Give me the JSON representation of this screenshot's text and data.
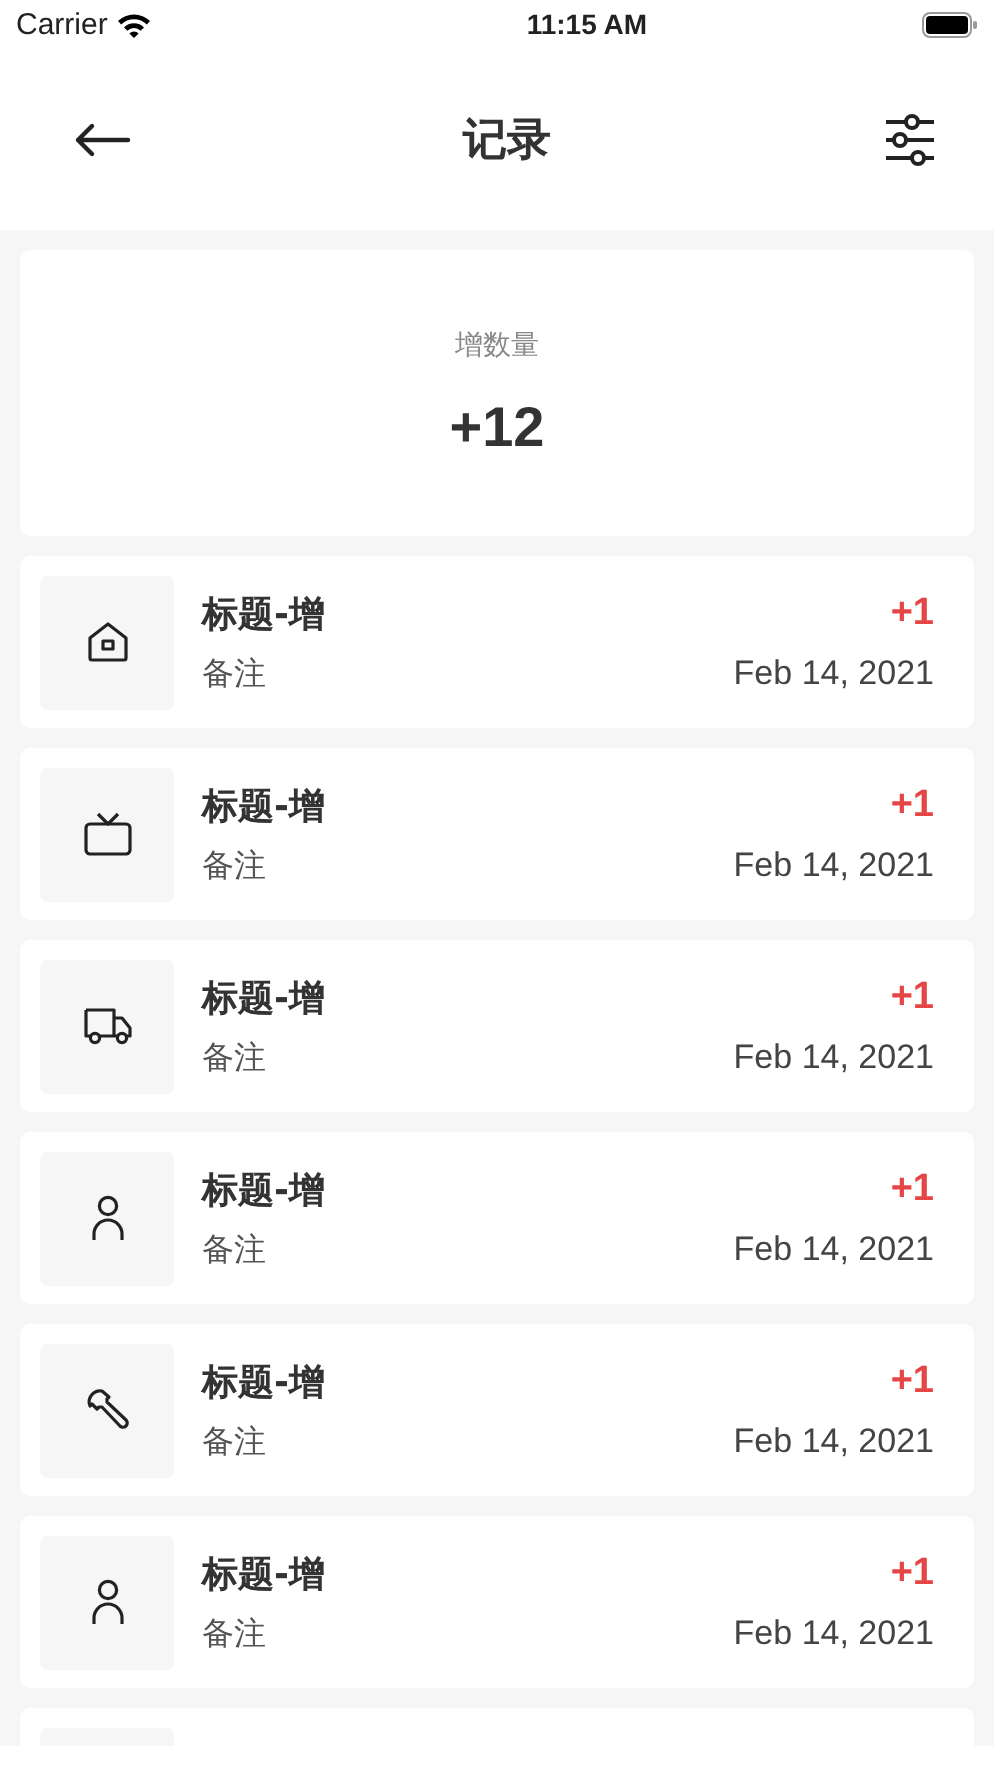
{
  "status_bar": {
    "carrier": "Carrier",
    "time": "11:15 AM"
  },
  "header": {
    "title": "记录"
  },
  "summary": {
    "label": "增数量",
    "value": "+12"
  },
  "records": [
    {
      "kind": "house",
      "title": "标题-增",
      "note": "备注",
      "amount": "+1",
      "date": "Feb 14, 2021"
    },
    {
      "kind": "tv",
      "title": "标题-增",
      "note": "备注",
      "amount": "+1",
      "date": "Feb 14, 2021"
    },
    {
      "kind": "truck",
      "title": "标题-增",
      "note": "备注",
      "amount": "+1",
      "date": "Feb 14, 2021"
    },
    {
      "kind": "person",
      "title": "标题-增",
      "note": "备注",
      "amount": "+1",
      "date": "Feb 14, 2021"
    },
    {
      "kind": "wrench",
      "title": "标题-增",
      "note": "备注",
      "amount": "+1",
      "date": "Feb 14, 2021"
    },
    {
      "kind": "person",
      "title": "标题-增",
      "note": "备注",
      "amount": "+1",
      "date": "Feb 14, 2021"
    }
  ]
}
